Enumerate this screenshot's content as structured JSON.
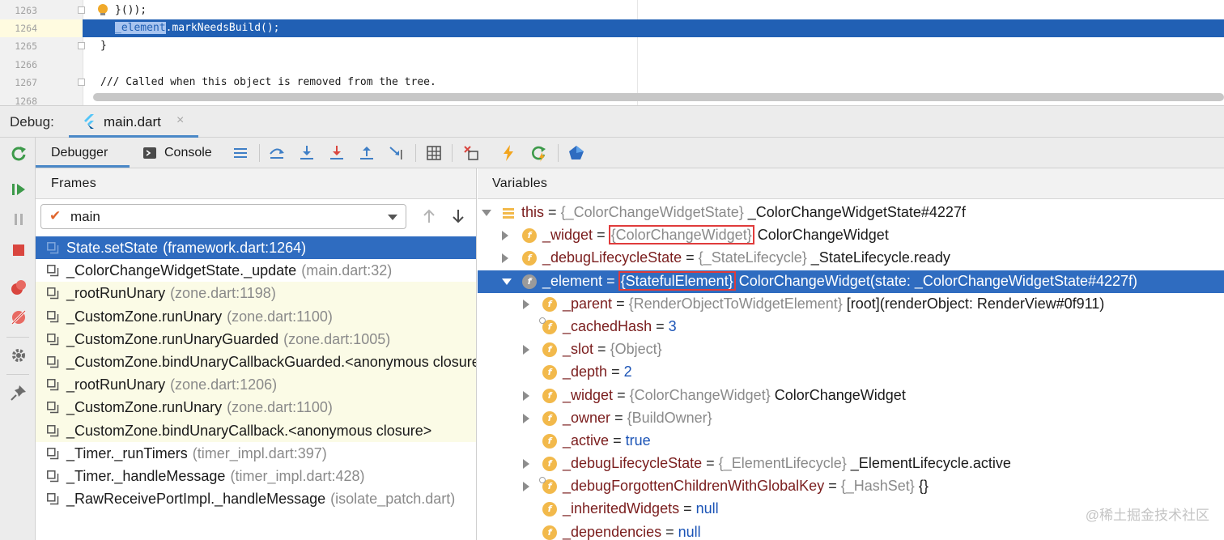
{
  "editor": {
    "lines": [
      {
        "num": "1263",
        "code": "}());"
      },
      {
        "num": "1264",
        "code_selected": "_element",
        "code_rest": ".markNeedsBuild();"
      },
      {
        "num": "1265",
        "code": "}"
      },
      {
        "num": "1266",
        "code": ""
      },
      {
        "num": "1267",
        "code": "/// Called when this object is removed from the tree."
      },
      {
        "num": "1268",
        "code": ""
      }
    ]
  },
  "debug": {
    "label": "Debug:",
    "run_tab": "main.dart",
    "tab_close": "×"
  },
  "toolbar": {
    "debugger_tab": "Debugger",
    "console_tab": "Console"
  },
  "frames": {
    "header": "Frames",
    "thread": "main",
    "check_glyph": "✔",
    "items": [
      {
        "name": "State.setState",
        "loc": "(framework.dart:1264)"
      },
      {
        "name": "_ColorChangeWidgetState._update",
        "loc": "(main.dart:32)"
      },
      {
        "name": "_rootRunUnary",
        "loc": "(zone.dart:1198)"
      },
      {
        "name": "_CustomZone.runUnary",
        "loc": "(zone.dart:1100)"
      },
      {
        "name": "_CustomZone.runUnaryGuarded",
        "loc": "(zone.dart:1005)"
      },
      {
        "name": "_CustomZone.bindUnaryCallbackGuarded.<anonymous closure>",
        "loc": ""
      },
      {
        "name": "_rootRunUnary",
        "loc": "(zone.dart:1206)"
      },
      {
        "name": "_CustomZone.runUnary",
        "loc": "(zone.dart:1100)"
      },
      {
        "name": "_CustomZone.bindUnaryCallback.<anonymous closure>",
        "loc": ""
      },
      {
        "name": "_Timer._runTimers",
        "loc": "(timer_impl.dart:397)"
      },
      {
        "name": "_Timer._handleMessage",
        "loc": "(timer_impl.dart:428)"
      },
      {
        "name": "_RawReceivePortImpl._handleMessage",
        "loc": "(isolate_patch.dart)"
      }
    ]
  },
  "variables": {
    "header": "Variables",
    "items": [
      {
        "name": "this",
        "type": "{_ColorChangeWidgetState}",
        "value": "_ColorChangeWidgetState#4227f"
      },
      {
        "name": "_widget",
        "type": "{ColorChangeWidget}",
        "value": "ColorChangeWidget"
      },
      {
        "name": "_debugLifecycleState",
        "type": "{_StateLifecycle}",
        "value": "_StateLifecycle.ready"
      },
      {
        "name": "_element",
        "type": "{StatefulElement}",
        "value": "ColorChangeWidget(state: _ColorChangeWidgetState#4227f)"
      },
      {
        "name": "_parent",
        "type": "{RenderObjectToWidgetElement}",
        "value": "[root](renderObject: RenderView#0f911)"
      },
      {
        "name": "_cachedHash",
        "value_num": "3"
      },
      {
        "name": "_slot",
        "type": "{Object}"
      },
      {
        "name": "_depth",
        "value_num": "2"
      },
      {
        "name": "_widget",
        "type": "{ColorChangeWidget}",
        "value": "ColorChangeWidget"
      },
      {
        "name": "_owner",
        "type": "{BuildOwner}"
      },
      {
        "name": "_active",
        "value_num": "true"
      },
      {
        "name": "_debugLifecycleState",
        "type": "{_ElementLifecycle}",
        "value": "_ElementLifecycle.active"
      },
      {
        "name": "_debugForgottenChildrenWithGlobalKey",
        "type": "{_HashSet}",
        "value": "{}"
      },
      {
        "name": "_inheritedWidgets",
        "value_num": "null"
      },
      {
        "name": "_dependencies",
        "value_num": "null"
      }
    ]
  },
  "icons": {
    "field": "f",
    "equals": "="
  },
  "watermark": "@稀土掘金技术社区",
  "colors": {
    "selection": "#2f6cc0",
    "editor_selection": "#2160b4",
    "highlight_box": "#e03b3b",
    "field_icon": "#f2b94b",
    "library_frame_bg": "#fbfbe6"
  }
}
